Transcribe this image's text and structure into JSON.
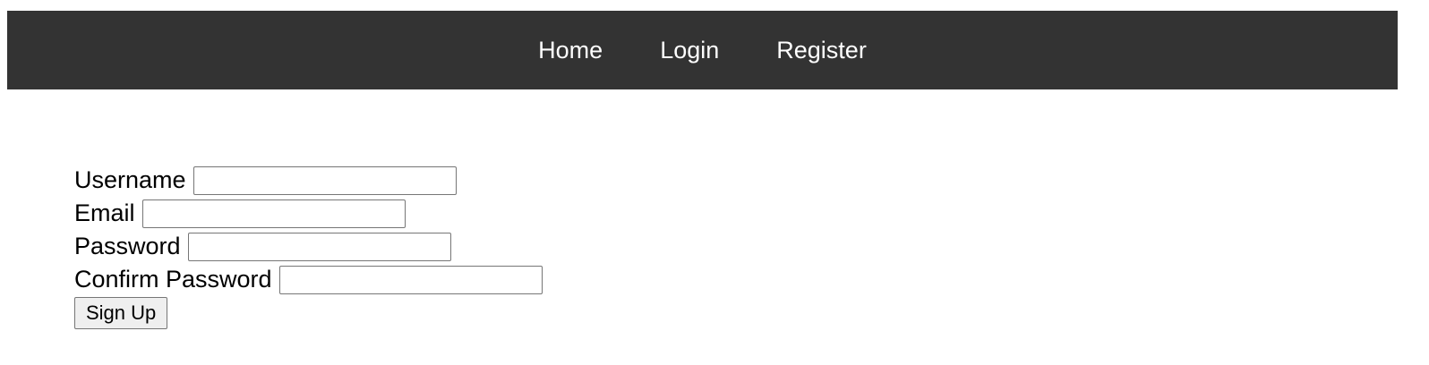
{
  "nav": {
    "items": [
      {
        "label": "Home"
      },
      {
        "label": "Login"
      },
      {
        "label": "Register"
      }
    ]
  },
  "form": {
    "username": {
      "label": "Username",
      "value": "",
      "placeholder": ""
    },
    "email": {
      "label": "Email",
      "value": "",
      "placeholder": ""
    },
    "password": {
      "label": "Password",
      "value": "",
      "placeholder": ""
    },
    "confirm_password": {
      "label": "Confirm Password",
      "value": "",
      "placeholder": ""
    },
    "submit_label": "Sign Up"
  },
  "colors": {
    "navbar_bg": "#333333",
    "nav_text": "#ffffff",
    "button_bg": "#efefef"
  }
}
